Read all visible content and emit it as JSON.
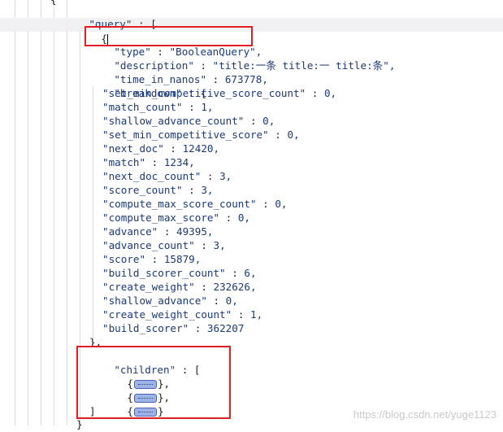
{
  "top_key": "\"query\"",
  "open_brace": "{",
  "fields": {
    "type": {
      "key": "\"type\"",
      "value": "\"BooleanQuery\","
    },
    "description": {
      "key": "\"description\"",
      "value": "\"title:一条 title:一 title:条\","
    },
    "time_in_nanos": {
      "key": "\"time_in_nanos\"",
      "value": "673778,"
    }
  },
  "breakdown_key": "\"breakdown\"",
  "breakdown": [
    {
      "key": "\"set_min_competitive_score_count\"",
      "value": "0,"
    },
    {
      "key": "\"match_count\"",
      "value": "1,"
    },
    {
      "key": "\"shallow_advance_count\"",
      "value": "0,"
    },
    {
      "key": "\"set_min_competitive_score\"",
      "value": "0,"
    },
    {
      "key": "\"next_doc\"",
      "value": "12420,"
    },
    {
      "key": "\"match\"",
      "value": "1234,"
    },
    {
      "key": "\"next_doc_count\"",
      "value": "3,"
    },
    {
      "key": "\"score_count\"",
      "value": "3,"
    },
    {
      "key": "\"compute_max_score_count\"",
      "value": "0,"
    },
    {
      "key": "\"compute_max_score\"",
      "value": "0,"
    },
    {
      "key": "\"advance\"",
      "value": "49395,"
    },
    {
      "key": "\"advance_count\"",
      "value": "3,"
    },
    {
      "key": "\"score\"",
      "value": "15879,"
    },
    {
      "key": "\"build_scorer_count\"",
      "value": "6,"
    },
    {
      "key": "\"create_weight\"",
      "value": "232626,"
    },
    {
      "key": "\"shallow_advance\"",
      "value": "0,"
    },
    {
      "key": "\"create_weight_count\"",
      "value": "1,"
    },
    {
      "key": "\"build_scorer\"",
      "value": "362207"
    }
  ],
  "breakdown_close": "},",
  "children_key": "\"children\"",
  "children": [
    {
      "open": "{",
      "close": "},"
    },
    {
      "open": "{",
      "close": "},"
    },
    {
      "open": "{",
      "close": "}"
    }
  ],
  "children_close": "]",
  "watermark": "https://blog.csdn.net/yuge1123",
  "colors": {
    "key": "#1b3a7a",
    "highlight_box": "#e02020",
    "collapsed_fill": "#9fb4e6"
  }
}
